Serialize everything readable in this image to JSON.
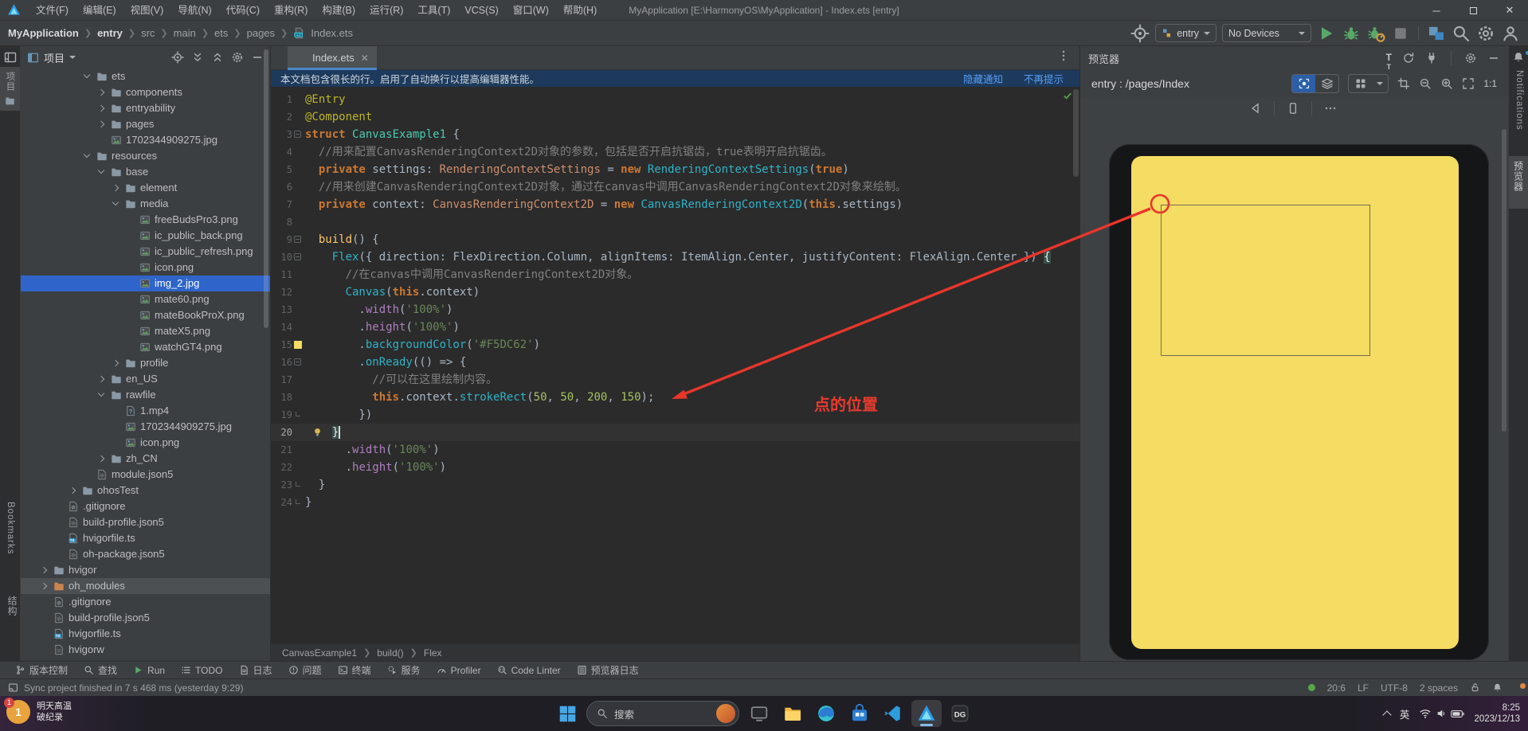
{
  "titlebar": {
    "title": "MyApplication [E:\\HarmonyOS\\MyApplication] - Index.ets [entry]",
    "menus": [
      "文件(F)",
      "编辑(E)",
      "视图(V)",
      "导航(N)",
      "代码(C)",
      "重构(R)",
      "构建(B)",
      "运行(R)",
      "工具(T)",
      "VCS(S)",
      "窗口(W)",
      "帮助(H)"
    ]
  },
  "toolbar": {
    "breadcrumbs": [
      {
        "label": "MyApplication",
        "bold": true
      },
      {
        "label": "entry",
        "bold": true
      },
      {
        "label": "src"
      },
      {
        "label": "main"
      },
      {
        "label": "ets"
      },
      {
        "label": "pages"
      },
      {
        "label": "Index.ets",
        "icon": "ets"
      }
    ],
    "target_select": "entry",
    "device_select": "No Devices"
  },
  "left_stripe": {
    "project_tab": "项目",
    "bookmarks": "Bookmarks",
    "structure": "结构"
  },
  "right_stripe": {
    "notifications": "Notifications",
    "previewer_tab": "预览器"
  },
  "project": {
    "title": "项目",
    "tree": [
      {
        "label": "ets",
        "lvl": 3,
        "arrow": "open",
        "icon": "folder"
      },
      {
        "label": "components",
        "lvl": 4,
        "arrow": "closed",
        "icon": "folder"
      },
      {
        "label": "entryability",
        "lvl": 4,
        "arrow": "closed",
        "icon": "folder"
      },
      {
        "label": "pages",
        "lvl": 4,
        "arrow": "closed",
        "icon": "folder"
      },
      {
        "label": "1702344909275.jpg",
        "lvl": 4,
        "icon": "img"
      },
      {
        "label": "resources",
        "lvl": 3,
        "arrow": "open",
        "icon": "folder"
      },
      {
        "label": "base",
        "lvl": 4,
        "arrow": "open",
        "icon": "folder"
      },
      {
        "label": "element",
        "lvl": 5,
        "arrow": "closed",
        "icon": "folder"
      },
      {
        "label": "media",
        "lvl": 5,
        "arrow": "open",
        "icon": "folder"
      },
      {
        "label": "freeBudsPro3.png",
        "lvl": 6,
        "icon": "img"
      },
      {
        "label": "ic_public_back.png",
        "lvl": 6,
        "icon": "img"
      },
      {
        "label": "ic_public_refresh.png",
        "lvl": 6,
        "icon": "img"
      },
      {
        "label": "icon.png",
        "lvl": 6,
        "icon": "img"
      },
      {
        "label": "img_2.jpg",
        "lvl": 6,
        "icon": "img",
        "sel": "active"
      },
      {
        "label": "mate60.png",
        "lvl": 6,
        "icon": "img"
      },
      {
        "label": "mateBookProX.png",
        "lvl": 6,
        "icon": "img"
      },
      {
        "label": "mateX5.png",
        "lvl": 6,
        "icon": "img"
      },
      {
        "label": "watchGT4.png",
        "lvl": 6,
        "icon": "img"
      },
      {
        "label": "profile",
        "lvl": 5,
        "arrow": "closed",
        "icon": "folder"
      },
      {
        "label": "en_US",
        "lvl": 4,
        "arrow": "closed",
        "icon": "folder"
      },
      {
        "label": "rawfile",
        "lvl": 4,
        "arrow": "open",
        "icon": "folder"
      },
      {
        "label": "1.mp4",
        "lvl": 5,
        "icon": "mp4"
      },
      {
        "label": "1702344909275.jpg",
        "lvl": 5,
        "icon": "img"
      },
      {
        "label": "icon.png",
        "lvl": 5,
        "icon": "img"
      },
      {
        "label": "zh_CN",
        "lvl": 4,
        "arrow": "closed",
        "icon": "folder"
      },
      {
        "label": "module.json5",
        "lvl": 3,
        "icon": "json"
      },
      {
        "label": "ohosTest",
        "lvl": 2,
        "arrow": "closed",
        "icon": "folder"
      },
      {
        "label": ".gitignore",
        "lvl": 1,
        "icon": "git"
      },
      {
        "label": "build-profile.json5",
        "lvl": 1,
        "icon": "json"
      },
      {
        "label": "hvigorfile.ts",
        "lvl": 1,
        "icon": "ts"
      },
      {
        "label": "oh-package.json5",
        "lvl": 1,
        "icon": "json"
      },
      {
        "label": "hvigor",
        "lvl": 0,
        "arrow": "closed",
        "icon": "folder"
      },
      {
        "label": "oh_modules",
        "lvl": 0,
        "arrow": "closed",
        "icon": "folder-lib",
        "sel": "inactive"
      },
      {
        "label": ".gitignore",
        "lvl": 0,
        "icon": "git"
      },
      {
        "label": "build-profile.json5",
        "lvl": 0,
        "icon": "json"
      },
      {
        "label": "hvigorfile.ts",
        "lvl": 0,
        "icon": "ts"
      },
      {
        "label": "hvigorw",
        "lvl": 0,
        "icon": "file"
      }
    ]
  },
  "editor": {
    "tab": "Index.ets",
    "banner": {
      "text": "本文档包含很长的行。启用了自动换行以提高编辑器性能。",
      "hide_link": "隐藏通知",
      "dismiss_link": "不再提示"
    },
    "breadcrumbs": [
      "CanvasExample1",
      "build()",
      "Flex"
    ],
    "lines": [
      {
        "n": 1,
        "segs": [
          [
            "ann",
            "@Entry"
          ]
        ]
      },
      {
        "n": 2,
        "segs": [
          [
            "ann",
            "@Component"
          ]
        ]
      },
      {
        "n": 3,
        "fold": "m",
        "segs": [
          [
            "kw",
            "struct "
          ],
          [
            "cls",
            "CanvasExample1 "
          ],
          [
            "d",
            "{"
          ]
        ]
      },
      {
        "n": 4,
        "segs": [
          [
            "d",
            "  "
          ],
          [
            "c",
            "//用来配置CanvasRenderingContext2D对象的参数，包括是否开启抗锯齿，true表明开启抗锯齿。"
          ]
        ]
      },
      {
        "n": 5,
        "segs": [
          [
            "d",
            "  "
          ],
          [
            "kw",
            "private "
          ],
          [
            "d",
            "settings: "
          ],
          [
            "ty",
            "RenderingContextSettings "
          ],
          [
            "d",
            "= "
          ],
          [
            "kw",
            "new "
          ],
          [
            "ct",
            "RenderingContextSettings"
          ],
          [
            "d",
            "("
          ],
          [
            "kw",
            "true"
          ],
          [
            "d",
            ")"
          ]
        ]
      },
      {
        "n": 6,
        "segs": [
          [
            "d",
            "  "
          ],
          [
            "c",
            "//用来创建CanvasRenderingContext2D对象，通过在canvas中调用CanvasRenderingContext2D对象来绘制。"
          ]
        ]
      },
      {
        "n": 7,
        "segs": [
          [
            "d",
            "  "
          ],
          [
            "kw",
            "private "
          ],
          [
            "d",
            "context: "
          ],
          [
            "ty",
            "CanvasRenderingContext2D "
          ],
          [
            "d",
            "= "
          ],
          [
            "kw",
            "new "
          ],
          [
            "ct",
            "CanvasRenderingContext2D"
          ],
          [
            "d",
            "("
          ],
          [
            "kw",
            "this"
          ],
          [
            "d",
            "."
          ],
          [
            "pr",
            "settings"
          ],
          [
            "d",
            ")"
          ]
        ]
      },
      {
        "n": 8,
        "segs": []
      },
      {
        "n": 9,
        "fold": "m",
        "segs": [
          [
            "d",
            "  "
          ],
          [
            "fn",
            "build"
          ],
          [
            "d",
            "() {"
          ]
        ]
      },
      {
        "n": 10,
        "fold": "m",
        "segs": [
          [
            "d",
            "    "
          ],
          [
            "ct",
            "Flex"
          ],
          [
            "d",
            "({ direction: FlexDirection.Column, alignItems: ItemAlign.Center, justifyContent: FlexAlign.Center }) "
          ],
          [
            "bh",
            "{"
          ]
        ]
      },
      {
        "n": 11,
        "segs": [
          [
            "d",
            "      "
          ],
          [
            "c",
            "//在canvas中调用CanvasRenderingContext2D对象。"
          ]
        ]
      },
      {
        "n": 12,
        "segs": [
          [
            "d",
            "      "
          ],
          [
            "ct",
            "Canvas"
          ],
          [
            "d",
            "("
          ],
          [
            "kw",
            "this"
          ],
          [
            "d",
            "."
          ],
          [
            "pr",
            "context"
          ],
          [
            "d",
            ")"
          ]
        ]
      },
      {
        "n": 13,
        "segs": [
          [
            "d",
            "        ."
          ],
          [
            "at",
            "width"
          ],
          [
            "d",
            "("
          ],
          [
            "s",
            "'100%'"
          ],
          [
            "d",
            ")"
          ]
        ]
      },
      {
        "n": 14,
        "segs": [
          [
            "d",
            "        ."
          ],
          [
            "at",
            "height"
          ],
          [
            "d",
            "("
          ],
          [
            "s",
            "'100%'"
          ],
          [
            "d",
            ")"
          ]
        ]
      },
      {
        "n": 15,
        "swatch": "#F5DC62",
        "segs": [
          [
            "d",
            "        ."
          ],
          [
            "mt",
            "backgroundColor"
          ],
          [
            "d",
            "("
          ],
          [
            "s",
            "'#F5DC62'"
          ],
          [
            "d",
            ")"
          ]
        ]
      },
      {
        "n": 16,
        "fold": "m",
        "segs": [
          [
            "d",
            "        ."
          ],
          [
            "mt",
            "onReady"
          ],
          [
            "d",
            "(() => {"
          ]
        ]
      },
      {
        "n": 17,
        "segs": [
          [
            "d",
            "          "
          ],
          [
            "c",
            "//可以在这里绘制内容。"
          ]
        ]
      },
      {
        "n": 18,
        "segs": [
          [
            "d",
            "          "
          ],
          [
            "kw",
            "this"
          ],
          [
            "d",
            "."
          ],
          [
            "pr",
            "context"
          ],
          [
            "d",
            "."
          ],
          [
            "mt",
            "strokeRect"
          ],
          [
            "d",
            "("
          ],
          [
            "n",
            "50"
          ],
          [
            "d",
            ", "
          ],
          [
            "n",
            "50"
          ],
          [
            "d",
            ", "
          ],
          [
            "n",
            "200"
          ],
          [
            "d",
            ", "
          ],
          [
            "n",
            "150"
          ],
          [
            "d",
            ");"
          ]
        ]
      },
      {
        "n": 19,
        "fold": "e",
        "segs": [
          [
            "d",
            "        })"
          ]
        ]
      },
      {
        "n": 20,
        "caret": true,
        "bulb": true,
        "segs": [
          [
            "d",
            "    "
          ],
          [
            "bh",
            "}"
          ]
        ]
      },
      {
        "n": 21,
        "segs": [
          [
            "d",
            "      ."
          ],
          [
            "at",
            "width"
          ],
          [
            "d",
            "("
          ],
          [
            "s",
            "'100%'"
          ],
          [
            "d",
            ")"
          ]
        ]
      },
      {
        "n": 22,
        "segs": [
          [
            "d",
            "      ."
          ],
          [
            "at",
            "height"
          ],
          [
            "d",
            "("
          ],
          [
            "s",
            "'100%'"
          ],
          [
            "d",
            ")"
          ]
        ]
      },
      {
        "n": 23,
        "fold": "e",
        "segs": [
          [
            "d",
            "  }"
          ]
        ]
      },
      {
        "n": 24,
        "fold": "e",
        "segs": [
          [
            "d",
            "}"
          ]
        ]
      }
    ]
  },
  "annotation": {
    "label": "点的位置"
  },
  "preview": {
    "title": "预览器",
    "page": "entry : /pages/Index",
    "zoom": "1:1"
  },
  "bottom_toolbar": [
    {
      "icon": "branch",
      "label": "版本控制"
    },
    {
      "icon": "search",
      "label": "查找"
    },
    {
      "icon": "play",
      "label": "Run"
    },
    {
      "icon": "todo",
      "label": "TODO"
    },
    {
      "icon": "doc",
      "label": "日志"
    },
    {
      "icon": "warn",
      "label": "问题"
    },
    {
      "icon": "term",
      "label": "终端"
    },
    {
      "icon": "serv",
      "label": "服务"
    },
    {
      "icon": "gauge",
      "label": "Profiler"
    },
    {
      "icon": "lint",
      "label": "Code Linter"
    },
    {
      "icon": "doclist",
      "label": "预览器日志"
    }
  ],
  "statusbar": {
    "message": "Sync project finished in 7 s 468 ms (yesterday 9:29)",
    "caret_pos": "20:6",
    "line_ending": "LF",
    "encoding": "UTF-8",
    "indent": "2 spaces"
  },
  "taskbar": {
    "widget": {
      "badge": "1",
      "line1": "明天高温",
      "line2": "破纪录"
    },
    "search_placeholder": "搜索",
    "apps": [
      {
        "name": "task-view",
        "icon": "monitor"
      },
      {
        "name": "file-explorer",
        "icon": "folder-win"
      },
      {
        "name": "edge",
        "icon": "edge"
      },
      {
        "name": "store",
        "icon": "store"
      },
      {
        "name": "vscode",
        "icon": "vscode"
      },
      {
        "name": "deveco-studio",
        "icon": "deveco",
        "active": true
      },
      {
        "name": "dg-app",
        "icon": "dg"
      }
    ],
    "tray": {
      "ime": "英",
      "time": "8:25",
      "date": "2023/12/13"
    }
  }
}
